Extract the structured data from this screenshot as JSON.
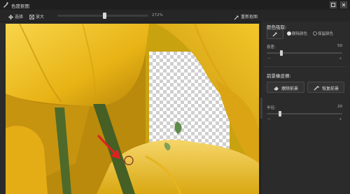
{
  "window": {
    "title": "色度抠图"
  },
  "toolbar": {
    "select_label": "选择",
    "zoom_label": "放大",
    "zoom_value": "272%",
    "reset_label": "重新抠图"
  },
  "panel": {
    "color_pick": {
      "title": "颜色吸取:",
      "radio_remove": "删除颜色",
      "radio_keep": "保留颜色",
      "selected": "删除颜色"
    },
    "tolerance": {
      "label": "容差:",
      "value": "50",
      "min": "−",
      "max": "+",
      "level": 0.18
    },
    "foreground": {
      "title": "前景橡皮擦:",
      "erase_button": "擦除前景",
      "restore_button": "恢复前景"
    },
    "radius": {
      "label": "半径:",
      "value": "20",
      "min": "−",
      "max": "+",
      "level": 0.18
    }
  },
  "colors": {
    "accent_red": "#e02020",
    "tulip_yellow": "#f2c21a",
    "stem_green": "#4e6a2a"
  },
  "icons": [
    "app-icon",
    "select-icon",
    "zoom-icon",
    "reset-icon",
    "eyedropper-icon",
    "eraser-icon",
    "brush-icon"
  ]
}
